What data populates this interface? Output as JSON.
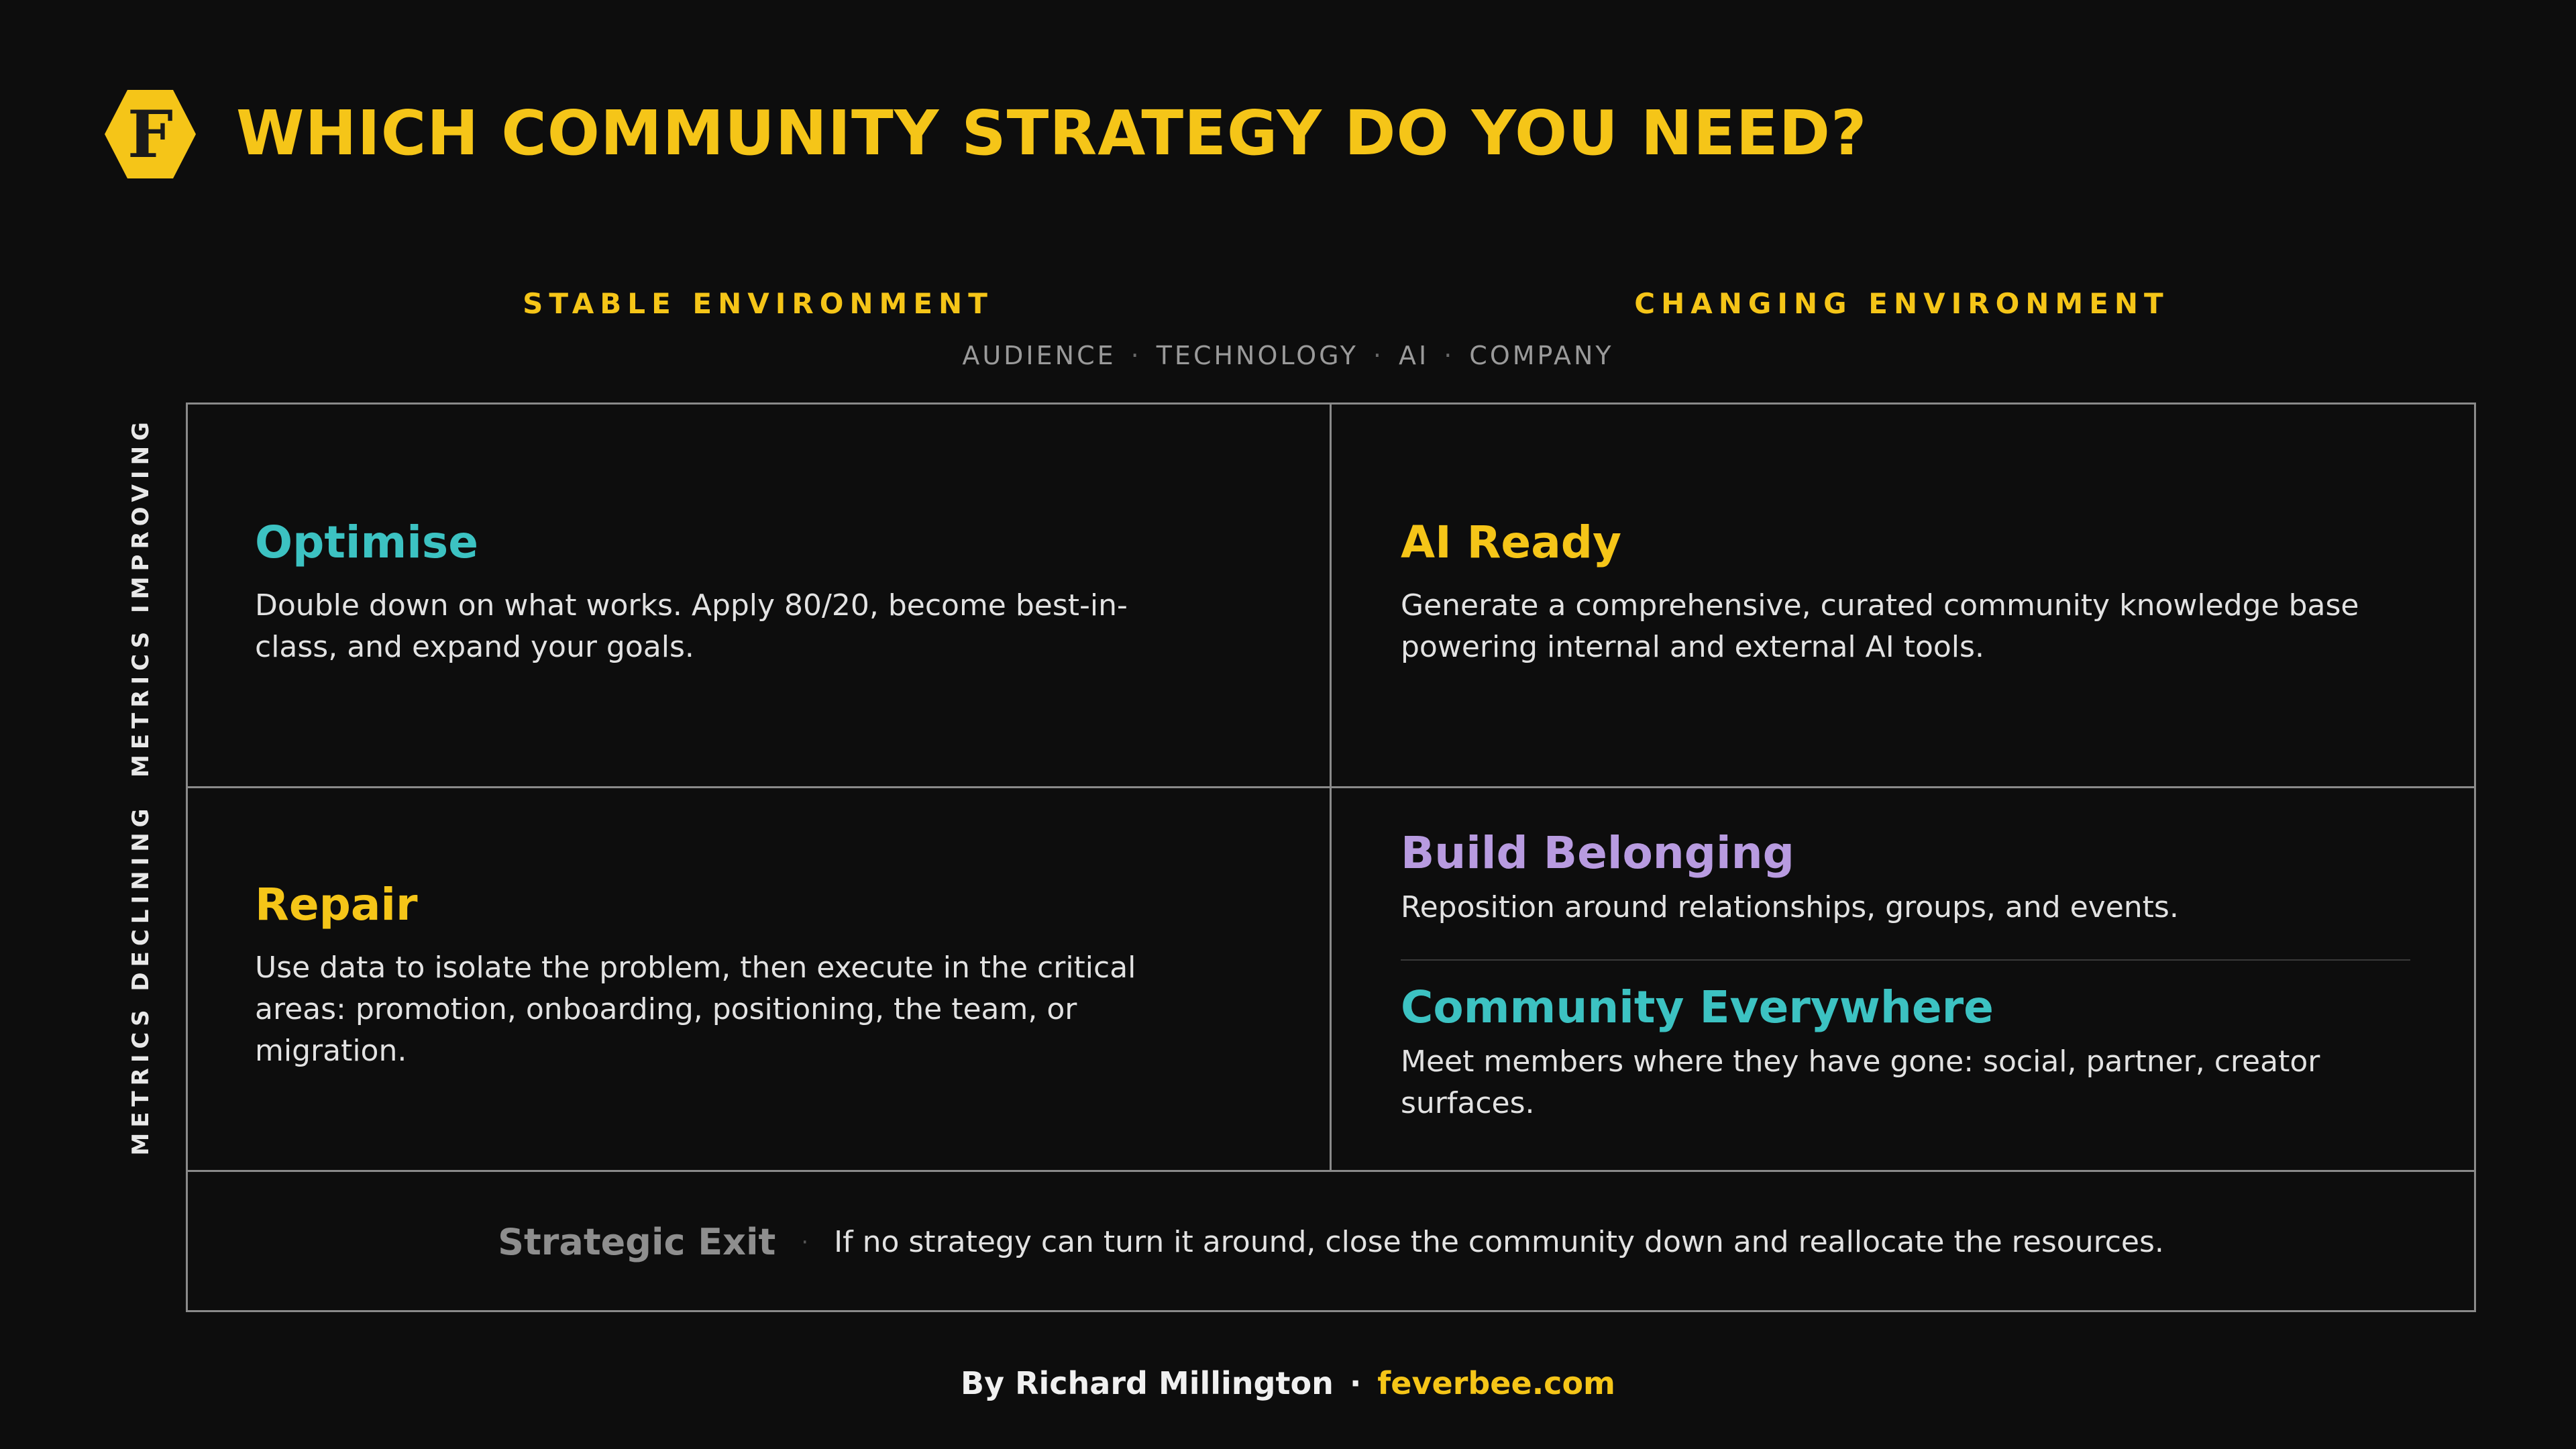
{
  "header": {
    "logo_letter": "F",
    "title": "WHICH COMMUNITY STRATEGY DO YOU NEED?"
  },
  "columns": {
    "stable": "STABLE ENVIRONMENT",
    "changing": "CHANGING ENVIRONMENT",
    "factors": [
      "AUDIENCE",
      "TECHNOLOGY",
      "AI",
      "COMPANY"
    ],
    "factor_separator": "·"
  },
  "rows": {
    "improving": "METRICS IMPROVING",
    "declining": "METRICS DECLINING"
  },
  "quadrants": {
    "optimise": {
      "title": "Optimise",
      "description": "Double down on what works. Apply 80/20, become best-in-class, and expand your goals."
    },
    "ai_ready": {
      "title": "AI Ready",
      "description": "Generate a comprehensive, curated community knowledge base powering internal and external AI tools."
    },
    "repair": {
      "title": "Repair",
      "description": "Use data to isolate the problem, then execute in the critical areas: promotion, onboarding, positioning, the team, or migration."
    },
    "build_belonging": {
      "title": "Build Belonging",
      "description": "Reposition around relationships, groups, and events."
    },
    "community_everywhere": {
      "title": "Community Everywhere",
      "description": "Meet members where they have gone: social, partner, creator surfaces."
    }
  },
  "exit": {
    "title": "Strategic Exit",
    "separator": "·",
    "description": "If no strategy can turn it around, close the community down and reallocate the resources."
  },
  "footer": {
    "author": "By Richard Millington",
    "separator": "·",
    "site": "feverbee.com"
  },
  "colors": {
    "background": "#0d0d0d",
    "brand_yellow": "#f5c518",
    "teal": "#3cc2c2",
    "lavender": "#b89be0",
    "grey": "#8e8e8e",
    "grid_line": "#8a8a8a"
  }
}
